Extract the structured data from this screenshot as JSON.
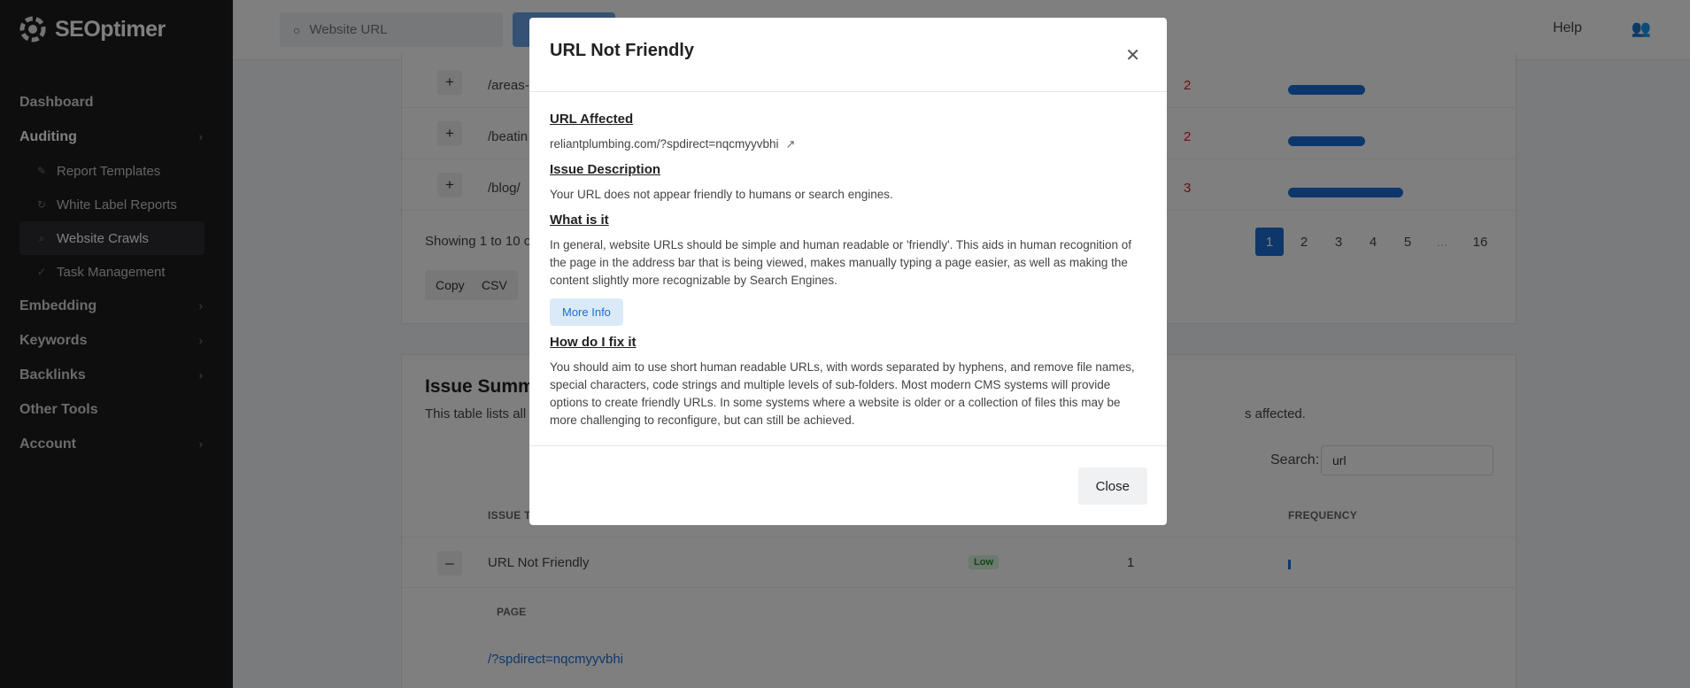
{
  "app": {
    "logo_text": "SEOptimer"
  },
  "sidebar": {
    "items": [
      {
        "label": "Dashboard"
      },
      {
        "label": "Auditing"
      },
      {
        "label": "Report Templates"
      },
      {
        "label": "White Label Reports"
      },
      {
        "label": "Website Crawls"
      },
      {
        "label": "Task Management"
      },
      {
        "label": "Embedding"
      },
      {
        "label": "Keywords"
      },
      {
        "label": "Backlinks"
      },
      {
        "label": "Other Tools"
      },
      {
        "label": "Account"
      }
    ]
  },
  "topbar": {
    "search_placeholder": "Website URL",
    "help_label": "Help"
  },
  "crawl_table": {
    "rows": [
      {
        "path": "/areas-",
        "issues": "2",
        "bar_fraction": 0.5
      },
      {
        "path": "/beatin",
        "issues": "2",
        "bar_fraction": 0.5
      },
      {
        "path": "/blog/",
        "issues": "3",
        "bar_fraction": 0.75
      }
    ],
    "showing_text": "Showing 1 to 10 of",
    "pagination": [
      "1",
      "2",
      "3",
      "4",
      "5",
      "...",
      "16"
    ],
    "active_page": "1",
    "export_buttons": [
      "Copy",
      "CSV"
    ]
  },
  "issue_summary": {
    "title": "Issue Summa",
    "subtitle": "This table lists all",
    "subtitle_tail": "s affected.",
    "search_label": "Search:",
    "search_value": "url",
    "col_issue": "ISSUE T",
    "col_frequency": "FREQUENCY",
    "row": {
      "name": "URL Not Friendly",
      "priority": "Low",
      "count": "1"
    },
    "page_col": "PAGE",
    "page_link": "/?spdirect=nqcmyyvbhi"
  },
  "modal": {
    "title": "URL Not Friendly",
    "url_affected_heading": "URL Affected",
    "url_affected": "reliantplumbing.com/?spdirect=nqcmyyvbhi",
    "issue_description_heading": "Issue Description",
    "issue_description": "Your URL does not appear friendly to humans or search engines.",
    "what_is_it_heading": "What is it",
    "what_is_it": "In general, website URLs should be simple and human readable or 'friendly'. This aids in human recognition of the page in the address bar that is being viewed, makes manually typing a page easier, as well as making the content slightly more recognizable by Search Engines.",
    "more_info_label": "More Info",
    "how_fix_heading": "How do I fix it",
    "how_fix": "You should aim to use short human readable URLs, with words separated by hyphens, and remove file names, special characters, code strings and multiple levels of sub-folders. Most modern CMS systems will provide options to create friendly URLs. In some systems where a website is older or a collection of files this may be more challenging to reconfigure, but can still be achieved.",
    "close_label": "Close"
  }
}
